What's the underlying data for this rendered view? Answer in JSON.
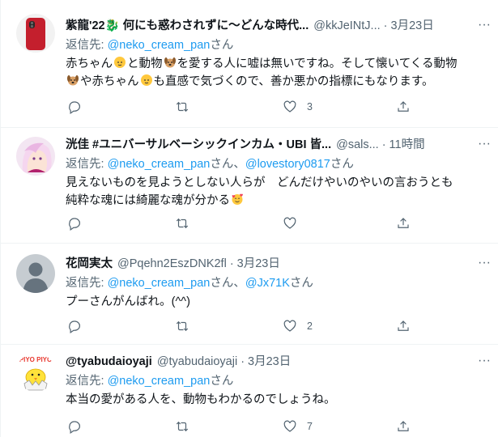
{
  "tweets": [
    {
      "name": "紫龍'22🐉 何にも惑わされずに〜どんな時代...",
      "handle": "@kkJeINtJ...",
      "sep": "·",
      "time": "3月23日",
      "reply_prefix": "返信先: ",
      "reply_to": "@neko_cream_pan",
      "reply_suffix": "さん",
      "line1_a": "赤ちゃん",
      "line1_b": "と動物",
      "line1_c": "を愛する人に嘘は無いですね。そして懐いてくる動物",
      "line2_a": "や赤ちゃん",
      "line2_b": "も直感で気づくので、善か悪かの指標にもなります。",
      "like_count": "3",
      "avatar": "red-phone-avatar"
    },
    {
      "name": "洸佳 #ユニバーサルベーシックインカム・UBI 皆...",
      "handle": "@sals...",
      "sep": "·",
      "time": "11時間",
      "reply_prefix": "返信先: ",
      "reply_to": "@neko_cream_pan",
      "reply_mid": "さん、",
      "reply_to2": "@lovestory0817",
      "reply_suffix": "さん",
      "line1": "見えないものを見ようとしない人らが　どんだけやいのやいの言おうとも",
      "line2": "純粋な魂には綺麗な魂が分かる",
      "avatar": "anime-girl-avatar"
    },
    {
      "name": "花岡実太",
      "handle": "@Pqehn2EszDNK2fl",
      "sep": "·",
      "time": "3月23日",
      "reply_prefix": "返信先: ",
      "reply_to": "@neko_cream_pan",
      "reply_mid": "さん、",
      "reply_to2": "@Jx71K",
      "reply_suffix": "さん",
      "line1": "プーさんがんばれ。(^^)",
      "like_count": "2",
      "avatar": "default-avatar"
    },
    {
      "name": "@tyabudaioyaji",
      "handle": "@tyabudaioyaji",
      "sep": "·",
      "time": "3月23日",
      "reply_prefix": "返信先: ",
      "reply_to": "@neko_cream_pan",
      "reply_suffix": "さん",
      "line1": "本当の愛がある人を、動物もわかるのでしょうね。",
      "like_count": "7",
      "avatar_text": "PIYO PIYO",
      "avatar": "chick-avatar"
    }
  ],
  "more_label": "···",
  "colors": {
    "link": "#1d9bf0",
    "muted": "#536471",
    "text": "#0f1419",
    "border": "#eff3f4"
  }
}
